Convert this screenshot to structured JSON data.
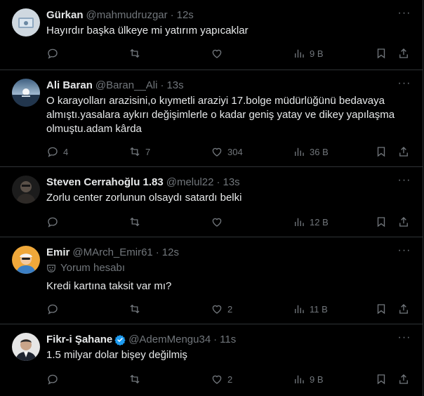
{
  "tweets": [
    {
      "name": "Gürkan",
      "handle": "@mahmudruzgar",
      "time": "12s",
      "text": "Hayırdır başka ülkeye mi yatırım yapıcaklar",
      "replies": "",
      "reposts": "",
      "likes": "",
      "views": "9 B"
    },
    {
      "name": "Ali Baran",
      "handle": "@Baran__Ali",
      "time": "13s",
      "text": "O karayolları arazisini,o kıymetli araziyi 17.bolge müdürlüğünü bedavaya almıştı.yasalara aykırı değişimlerle o kadar geniş yatay ve dikey yapılaşma olmuştu.adam kârda",
      "replies": "4",
      "reposts": "7",
      "likes": "304",
      "views": "36 B"
    },
    {
      "name": "Steven Cerrahoğlu 1.83",
      "handle": "@melul22",
      "time": "13s",
      "text": "Zorlu center zorlunun olsaydı satardı belki",
      "replies": "",
      "reposts": "",
      "likes": "",
      "views": "12 B"
    },
    {
      "name": "Emir",
      "handle": "@MArch_Emir61",
      "time": "12s",
      "badge": "Yorum hesabı",
      "text": "Kredi kartına taksit var mı?",
      "replies": "",
      "reposts": "",
      "likes": "2",
      "views": "11 B"
    },
    {
      "name": "Fikr-i Şahane",
      "handle": "@AdemMengu34",
      "time": "11s",
      "text": "1.5 milyar dolar bişey değilmiş",
      "replies": "",
      "reposts": "",
      "likes": "2",
      "views": "9 B"
    }
  ],
  "separator": "·",
  "more_label": "···",
  "colors": {
    "background": "#000000",
    "text": "#e7e9ea",
    "muted": "#71767b",
    "border": "#2f3336",
    "verified": "#1d9bf0"
  },
  "icons": [
    "reply-icon",
    "repost-icon",
    "like-icon",
    "views-icon",
    "bookmark-icon",
    "share-icon",
    "more-icon",
    "verified-badge-icon",
    "mask-icon"
  ]
}
